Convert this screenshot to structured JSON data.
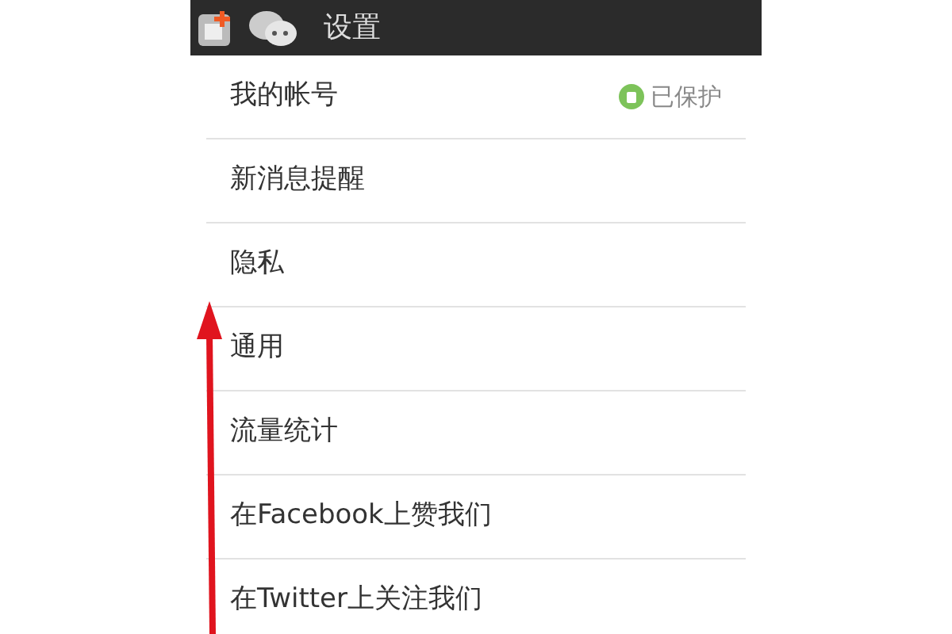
{
  "header": {
    "title": "设置"
  },
  "items": [
    {
      "label": "我的帐号",
      "status": "已保护"
    },
    {
      "label": "新消息提醒"
    },
    {
      "label": "隐私"
    },
    {
      "label": "通用"
    },
    {
      "label": "流量统计"
    },
    {
      "label": "在Facebook上赞我们"
    },
    {
      "label": "在Twitter上关注我们"
    }
  ]
}
